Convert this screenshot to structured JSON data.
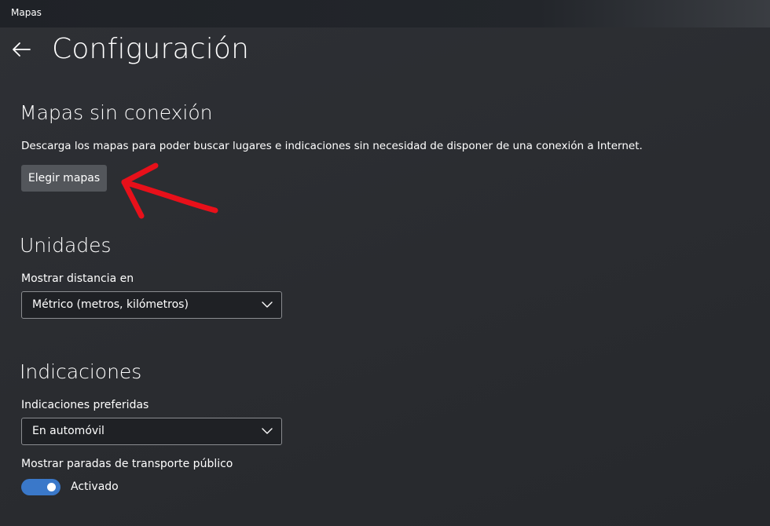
{
  "window": {
    "title": "Mapas"
  },
  "header": {
    "back_icon": "back-arrow-icon",
    "title": "Configuración"
  },
  "offline_maps": {
    "title": "Mapas sin conexión",
    "description": "Descarga los mapas para poder buscar lugares e indicaciones sin necesidad de disponer de una conexión a Internet.",
    "button_label": "Elegir mapas"
  },
  "units": {
    "title": "Unidades",
    "distance_label": "Mostrar distancia en",
    "distance_value": "Métrico (metros, kilómetros)"
  },
  "directions": {
    "title": "Indicaciones",
    "preferred_label": "Indicaciones preferidas",
    "preferred_value": "En automóvil",
    "transit_label": "Mostrar paradas de transporte público",
    "transit_toggle_state": "Activado",
    "transit_toggle_on": true
  },
  "colors": {
    "accent": "#3a78c9",
    "annotation": "#e8101a",
    "button_bg": "#53565b"
  },
  "annotation": {
    "icon": "red-arrow-annotation-icon"
  }
}
